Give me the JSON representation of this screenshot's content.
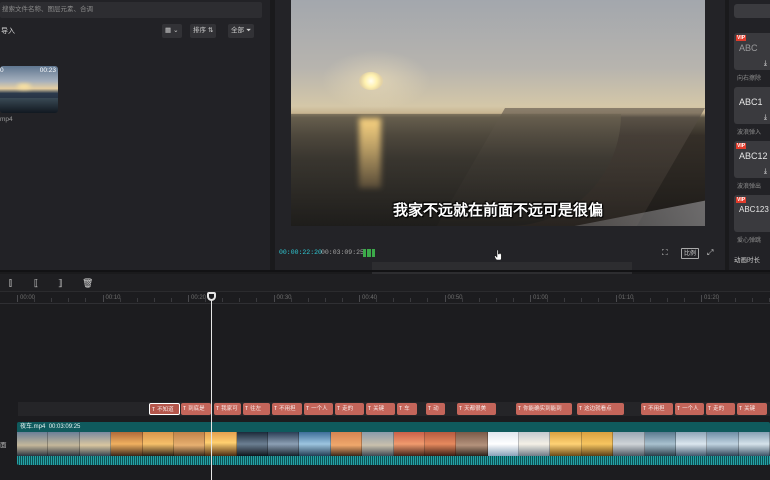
{
  "media": {
    "search_placeholder": "搜索文件名称、图层元素、合调",
    "import_label": "导入",
    "sort_label": "排序",
    "filter_label": "全部",
    "thumb_duration": "00:23",
    "thumb_tag": "0",
    "thumb_name": "mp4"
  },
  "player": {
    "subtitle": "我家不远就在前面不远可是很偏",
    "timecode_current": "00:00:22:20",
    "timecode_total": "00:03:09:25",
    "ratio_label": "比例"
  },
  "right_panel": {
    "cards": [
      {
        "vip": "VIP",
        "text": "ABC",
        "name": "向右擦除"
      },
      {
        "vip": "",
        "text": "ABC1",
        "name": "波浪弹入"
      },
      {
        "vip": "VIP",
        "text": "ABC12",
        "name": "波浪弹出"
      },
      {
        "vip": "VIP",
        "text": "ABC123",
        "name": "爱心弹跳"
      }
    ],
    "footer_label": "动画时长"
  },
  "timeline": {
    "ruler": [
      "00:00",
      "00:10",
      "00:20",
      "00:30",
      "00:40",
      "00:50",
      "01:00",
      "01:10",
      "01:20"
    ],
    "subtitle_clips": [
      "不知道",
      "到底是",
      "我家可",
      "往左",
      "不用担",
      "一个人",
      "走的",
      "关键",
      "车",
      "动",
      "天都很美",
      "你能确实到能到",
      "这边就看点",
      "不用担",
      "一个人",
      "走的",
      "关键"
    ],
    "video_clip_name": "夜车.mp4",
    "video_clip_duration": "00:03:09:25",
    "track_label": "面"
  },
  "colors": {
    "accent_timecode": "#2fc9d4",
    "subtitle_clip": "#c4655a",
    "video_track": "#0f5a5d",
    "vip_badge": "#e23c2c"
  }
}
